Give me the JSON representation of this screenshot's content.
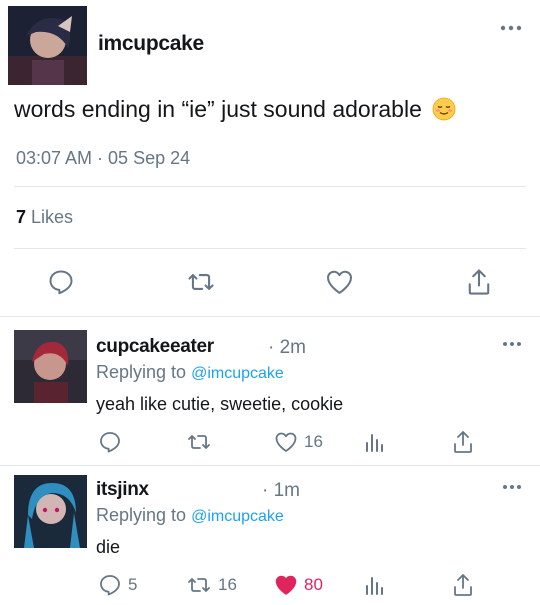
{
  "tweet": {
    "username": "imcupcake",
    "text": "words ending in “ie” just sound adorable",
    "emoji": "relieved-face-emoji",
    "timestamp": "03:07 AM · 05 Sep 24",
    "likes_count": "7",
    "likes_label": "Likes"
  },
  "replies": [
    {
      "username": "cupcakeeater",
      "time": "· 2m",
      "replying_label": "Replying to",
      "replying_handle": "@imcupcake",
      "text": "yeah like cutie, sweetie, cookie",
      "reply_count": "",
      "retweet_count": "",
      "like_count": "16",
      "liked": false
    },
    {
      "username": "itsjinx",
      "time": "· 1m",
      "replying_label": "Replying to",
      "replying_handle": "@imcupcake",
      "text": "die",
      "reply_count": "5",
      "retweet_count": "16",
      "like_count": "80",
      "liked": true
    }
  ],
  "colors": {
    "accent": "#1da1f2",
    "muted": "#657786",
    "like_red": "#e0245e",
    "divider": "#e1e8ed"
  },
  "icons": [
    "reply-icon",
    "retweet-icon",
    "heart-icon",
    "share-icon",
    "analytics-icon",
    "more-icon"
  ]
}
